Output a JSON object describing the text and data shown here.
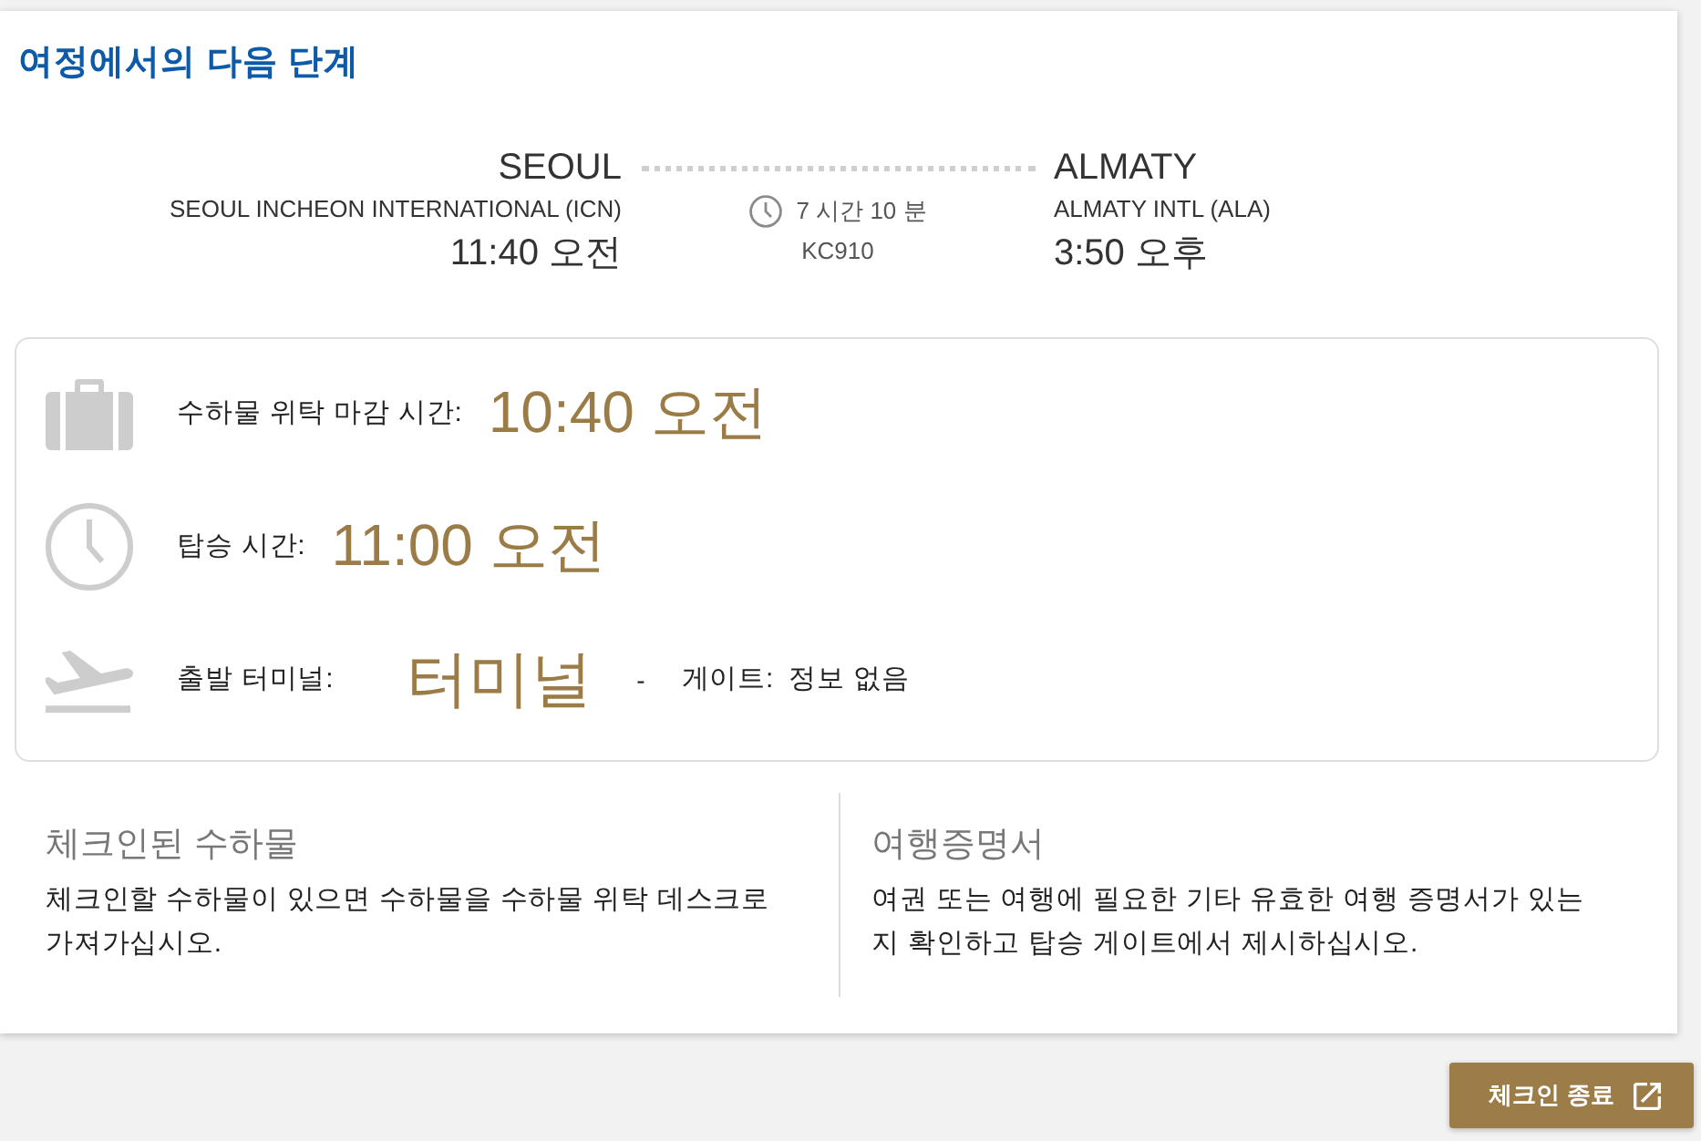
{
  "title": "여정에서의 다음 단계",
  "flight": {
    "origin": {
      "city": "SEOUL",
      "airport": "SEOUL INCHEON INTERNATIONAL (ICN)",
      "time": "11:40 오전"
    },
    "duration": "7 시간 10 분",
    "flight_number": "KC910",
    "destination": {
      "city": "ALMATY",
      "airport": "ALMATY INTL (ALA)",
      "time": "3:50 오후"
    }
  },
  "details": [
    {
      "kind": "baggage",
      "label": "수하물 위탁 마감 시간:",
      "value": "10:40 오전"
    },
    {
      "kind": "boarding",
      "label": "탑승 시간:",
      "value": "11:00 오전"
    },
    {
      "kind": "departure",
      "label": "출발 터미널:",
      "value": "터미널",
      "separator": "-",
      "gate_label": "게이트:",
      "gate_value": "정보 없음"
    }
  ],
  "notes": [
    {
      "heading": "체크인된 수하물",
      "text": "체크인할 수하물이 있으면 수하물을 수하물 위탁 데스크로 가져가십시오."
    },
    {
      "heading": "여행증명서",
      "text": "여권 또는 여행에 필요한 기타 유효한 여행 증명서가 있는지 확인하고 탑승 게이트에서 제시하십시오."
    }
  ],
  "button": {
    "label": "체크인 종료"
  }
}
